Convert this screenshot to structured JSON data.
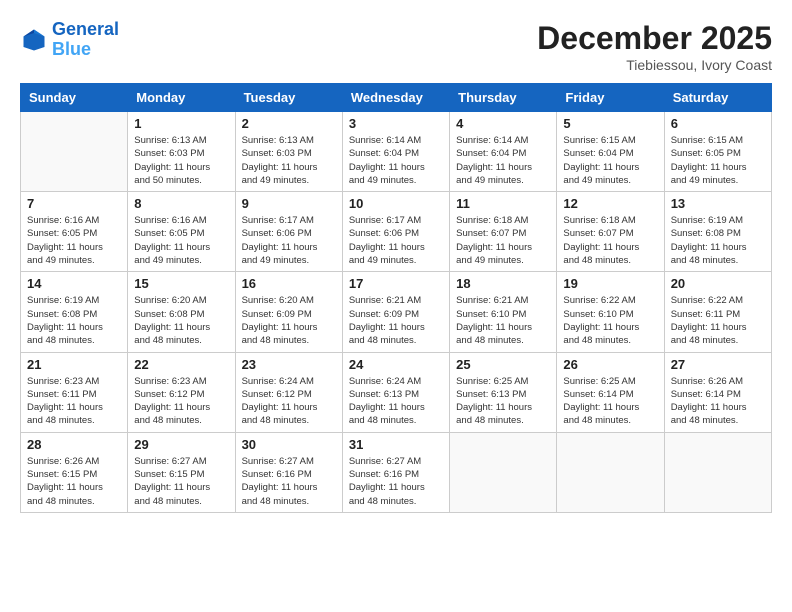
{
  "header": {
    "logo_line1": "General",
    "logo_line2": "Blue",
    "month_year": "December 2025",
    "location": "Tiebiessou, Ivory Coast"
  },
  "weekdays": [
    "Sunday",
    "Monday",
    "Tuesday",
    "Wednesday",
    "Thursday",
    "Friday",
    "Saturday"
  ],
  "weeks": [
    [
      {
        "day": "",
        "info": ""
      },
      {
        "day": "1",
        "info": "Sunrise: 6:13 AM\nSunset: 6:03 PM\nDaylight: 11 hours\nand 50 minutes."
      },
      {
        "day": "2",
        "info": "Sunrise: 6:13 AM\nSunset: 6:03 PM\nDaylight: 11 hours\nand 49 minutes."
      },
      {
        "day": "3",
        "info": "Sunrise: 6:14 AM\nSunset: 6:04 PM\nDaylight: 11 hours\nand 49 minutes."
      },
      {
        "day": "4",
        "info": "Sunrise: 6:14 AM\nSunset: 6:04 PM\nDaylight: 11 hours\nand 49 minutes."
      },
      {
        "day": "5",
        "info": "Sunrise: 6:15 AM\nSunset: 6:04 PM\nDaylight: 11 hours\nand 49 minutes."
      },
      {
        "day": "6",
        "info": "Sunrise: 6:15 AM\nSunset: 6:05 PM\nDaylight: 11 hours\nand 49 minutes."
      }
    ],
    [
      {
        "day": "7",
        "info": "Sunrise: 6:16 AM\nSunset: 6:05 PM\nDaylight: 11 hours\nand 49 minutes."
      },
      {
        "day": "8",
        "info": "Sunrise: 6:16 AM\nSunset: 6:05 PM\nDaylight: 11 hours\nand 49 minutes."
      },
      {
        "day": "9",
        "info": "Sunrise: 6:17 AM\nSunset: 6:06 PM\nDaylight: 11 hours\nand 49 minutes."
      },
      {
        "day": "10",
        "info": "Sunrise: 6:17 AM\nSunset: 6:06 PM\nDaylight: 11 hours\nand 49 minutes."
      },
      {
        "day": "11",
        "info": "Sunrise: 6:18 AM\nSunset: 6:07 PM\nDaylight: 11 hours\nand 49 minutes."
      },
      {
        "day": "12",
        "info": "Sunrise: 6:18 AM\nSunset: 6:07 PM\nDaylight: 11 hours\nand 48 minutes."
      },
      {
        "day": "13",
        "info": "Sunrise: 6:19 AM\nSunset: 6:08 PM\nDaylight: 11 hours\nand 48 minutes."
      }
    ],
    [
      {
        "day": "14",
        "info": "Sunrise: 6:19 AM\nSunset: 6:08 PM\nDaylight: 11 hours\nand 48 minutes."
      },
      {
        "day": "15",
        "info": "Sunrise: 6:20 AM\nSunset: 6:08 PM\nDaylight: 11 hours\nand 48 minutes."
      },
      {
        "day": "16",
        "info": "Sunrise: 6:20 AM\nSunset: 6:09 PM\nDaylight: 11 hours\nand 48 minutes."
      },
      {
        "day": "17",
        "info": "Sunrise: 6:21 AM\nSunset: 6:09 PM\nDaylight: 11 hours\nand 48 minutes."
      },
      {
        "day": "18",
        "info": "Sunrise: 6:21 AM\nSunset: 6:10 PM\nDaylight: 11 hours\nand 48 minutes."
      },
      {
        "day": "19",
        "info": "Sunrise: 6:22 AM\nSunset: 6:10 PM\nDaylight: 11 hours\nand 48 minutes."
      },
      {
        "day": "20",
        "info": "Sunrise: 6:22 AM\nSunset: 6:11 PM\nDaylight: 11 hours\nand 48 minutes."
      }
    ],
    [
      {
        "day": "21",
        "info": "Sunrise: 6:23 AM\nSunset: 6:11 PM\nDaylight: 11 hours\nand 48 minutes."
      },
      {
        "day": "22",
        "info": "Sunrise: 6:23 AM\nSunset: 6:12 PM\nDaylight: 11 hours\nand 48 minutes."
      },
      {
        "day": "23",
        "info": "Sunrise: 6:24 AM\nSunset: 6:12 PM\nDaylight: 11 hours\nand 48 minutes."
      },
      {
        "day": "24",
        "info": "Sunrise: 6:24 AM\nSunset: 6:13 PM\nDaylight: 11 hours\nand 48 minutes."
      },
      {
        "day": "25",
        "info": "Sunrise: 6:25 AM\nSunset: 6:13 PM\nDaylight: 11 hours\nand 48 minutes."
      },
      {
        "day": "26",
        "info": "Sunrise: 6:25 AM\nSunset: 6:14 PM\nDaylight: 11 hours\nand 48 minutes."
      },
      {
        "day": "27",
        "info": "Sunrise: 6:26 AM\nSunset: 6:14 PM\nDaylight: 11 hours\nand 48 minutes."
      }
    ],
    [
      {
        "day": "28",
        "info": "Sunrise: 6:26 AM\nSunset: 6:15 PM\nDaylight: 11 hours\nand 48 minutes."
      },
      {
        "day": "29",
        "info": "Sunrise: 6:27 AM\nSunset: 6:15 PM\nDaylight: 11 hours\nand 48 minutes."
      },
      {
        "day": "30",
        "info": "Sunrise: 6:27 AM\nSunset: 6:16 PM\nDaylight: 11 hours\nand 48 minutes."
      },
      {
        "day": "31",
        "info": "Sunrise: 6:27 AM\nSunset: 6:16 PM\nDaylight: 11 hours\nand 48 minutes."
      },
      {
        "day": "",
        "info": ""
      },
      {
        "day": "",
        "info": ""
      },
      {
        "day": "",
        "info": ""
      }
    ]
  ]
}
